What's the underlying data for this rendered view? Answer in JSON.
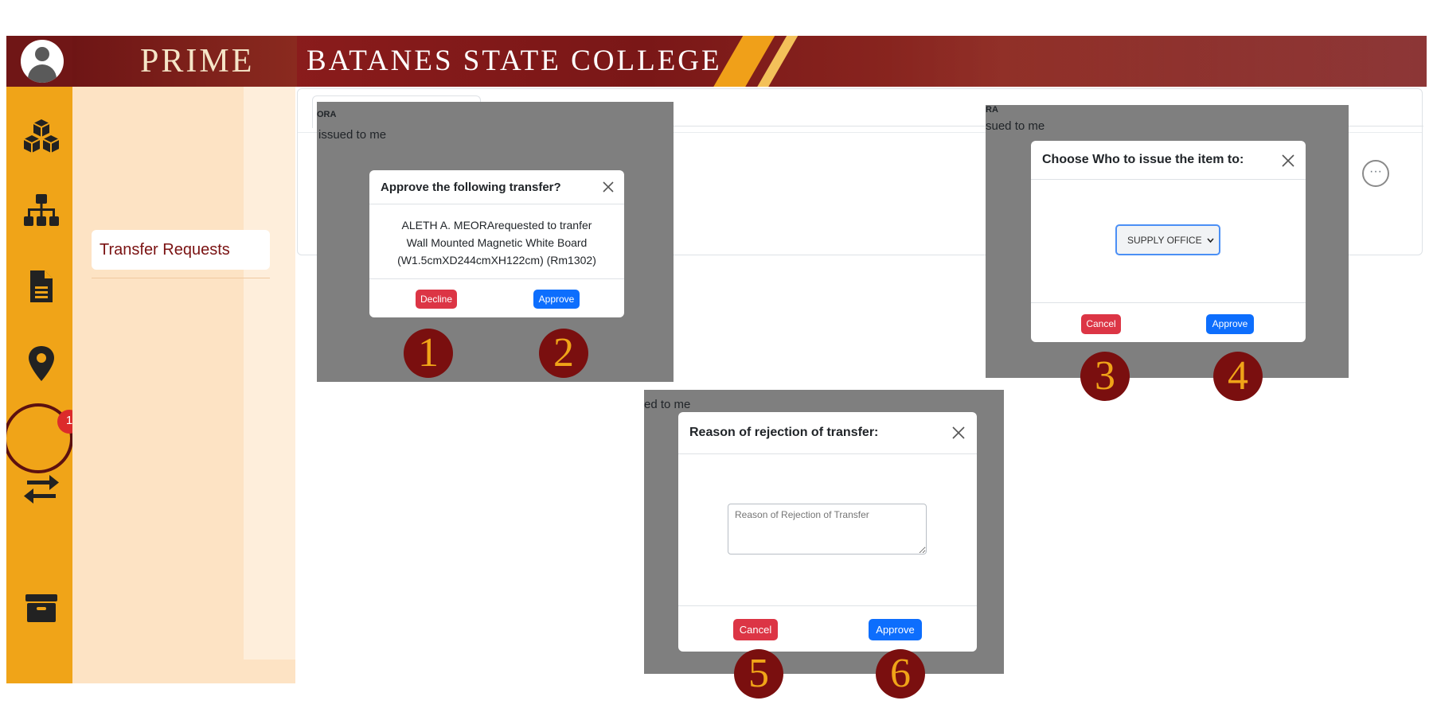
{
  "header": {
    "logo": "PRIME",
    "title": "BATANES STATE COLLEGE"
  },
  "sidebar": {
    "icons": [
      "cubes-icon",
      "sitemap-icon",
      "file-icon",
      "map-marker-icon",
      "exchange-icon",
      "archive-icon"
    ],
    "badge": "1"
  },
  "submenu": {
    "item": "Transfer Requests"
  },
  "content": {
    "more_label": "···"
  },
  "panel1": {
    "bg_tab": "ORA",
    "bg_text": "issued to me",
    "modal": {
      "title": "Approve the following transfer?",
      "body_line1": "ALETH A. MEORArequested to tranfer",
      "body_line2": "Wall Mounted Magnetic White Board",
      "body_line3": "(W1.5cmXD244cmXH122cm) (Rm1302)",
      "decline": "Decline",
      "approve": "Approve"
    }
  },
  "panel2": {
    "bg_tab": "RA",
    "bg_text": "sued to me",
    "modal": {
      "title": "Choose Who to issue the item to:",
      "select_value": "SUPPLY OFFICE",
      "cancel": "Cancel",
      "approve": "Approve"
    }
  },
  "panel3": {
    "bg_text": "ed to me",
    "modal": {
      "title": "Reason of rejection of transfer:",
      "placeholder": "Reason of Rejection of Transfer",
      "cancel": "Cancel",
      "approve": "Approve"
    }
  },
  "markers": [
    "1",
    "2",
    "3",
    "4",
    "5",
    "6"
  ],
  "colors": {
    "banner_red": "#7a1717",
    "sidebar_gold": "#f0a418",
    "submenu_bg": "#fde3c4",
    "marker_red": "#7a0f0f",
    "btn_red": "#dc3545",
    "btn_blue": "#0d6efd"
  }
}
